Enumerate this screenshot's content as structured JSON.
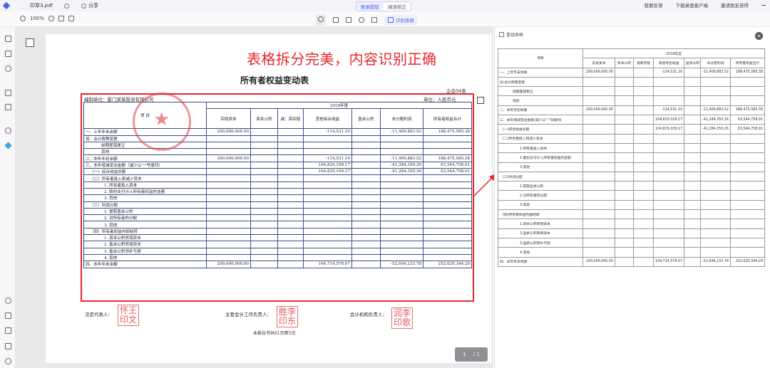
{
  "titlebar": {
    "file_name": "印章3.pdf",
    "share_label": "分享",
    "mode_tabs": [
      "数据提取",
      "阅读校正"
    ],
    "links": [
      "我要反馈",
      "下载桌面客户端",
      "邀请朋友获得"
    ]
  },
  "toolbar": {
    "zoom": "100%",
    "split_label": "识别表格"
  },
  "headline": "表格拆分完美，内容识别正确",
  "document": {
    "title": "所有者权益变动表",
    "code": "企会04表",
    "unit": "单位：人民币元",
    "company": "编制单位：厦门某某投资有限公司",
    "header": {
      "item": "项 目",
      "year": "2018年度",
      "cols": [
        "实收资本",
        "资本公积",
        "减：库存股",
        "其他综合收益",
        "盈余公积",
        "未分配利润",
        "所有者权益合计"
      ]
    },
    "rows": [
      {
        "label": "一、上年年末余额",
        "c1": "200,000,000.00",
        "c4": "-114,531.10",
        "c6": "-11,409,883.52",
        "c7": "188,475,585.38"
      },
      {
        "label": "加：会计政策变更"
      },
      {
        "label": "前期差错更正"
      },
      {
        "label": "其他"
      },
      {
        "label": "二、本年年初余额",
        "c1": "200,000,000.00",
        "c4": "-114,531.10",
        "c6": "-11,409,883.52",
        "c7": "188,475,585.38"
      },
      {
        "label": "三、本年增减变动金额（减少以\"-\"号填列）",
        "c4": "104,829,109.17",
        "c6": "-41,284,350.26",
        "c7": "63,544,758.91"
      },
      {
        "label": "（一）综合收益总额",
        "c4": "104,829,109.17",
        "c6": "-41,284,350.26",
        "c7": "63,544,758.91"
      },
      {
        "label": "（二）所有者投入和减少资本"
      },
      {
        "label": "1. 所有者投入资本"
      },
      {
        "label": "2. 股份支付计入所有者权益的金额"
      },
      {
        "label": "3. 其他"
      },
      {
        "label": "（三）利润分配"
      },
      {
        "label": "1. 提取盈余公积"
      },
      {
        "label": "2. 对所有者的分配"
      },
      {
        "label": "3. 其他"
      },
      {
        "label": "（四）所有者权益内部结转"
      },
      {
        "label": "1. 资本公积转增资本"
      },
      {
        "label": "2. 盈余公积转增资本"
      },
      {
        "label": "3. 盈余公积弥补亏损"
      },
      {
        "label": "4. 其他"
      },
      {
        "label": "四、本年年末余额",
        "c1": "200,000,000.00",
        "c4": "104,714,578.07",
        "c6": "-52,694,233.78",
        "c7": "252,020,344.29"
      }
    ],
    "signatures": {
      "legal": "法定代表人：",
      "accounting_head": "主管会计工作负责人：",
      "accounting_org": "会计机构负责人：",
      "seal1": [
        "怀王",
        "印文"
      ],
      "seal2": [
        "胜李",
        "印东"
      ],
      "seal3": [
        "润李",
        "印歌"
      ]
    },
    "footer": "本报告书共61页第5页"
  },
  "pager": {
    "current": "1",
    "total": "/ 1"
  },
  "result_panel": {
    "title": "重组表格",
    "header": {
      "item": "项目",
      "year": "2018年度",
      "cols": [
        "实收资本",
        "资本公积",
        "减库存股",
        "其他综合收益",
        "盈余公积",
        "未分配利润",
        "所有者权益合计"
      ]
    },
    "rows": [
      {
        "label": "一、上年年末余额",
        "c1": "200,000,000.00",
        "c4": "-114,531.10",
        "c6": "-11,409,883.52",
        "c7": "188,475,585.38"
      },
      {
        "label": "加:会计政策变更"
      },
      {
        "label": "前期差错更正"
      },
      {
        "label": "其他"
      },
      {
        "label": "二、本年年初余额",
        "c1": "200,000,000.00",
        "c4": "-114,531.10",
        "c6": "-11,409,883.52",
        "c7": "188,475,585.38"
      },
      {
        "label": "三、本年增减变动金额(减少以\"-\"号填列)",
        "c4": "104,829,109.17",
        "c6": "-41,284,350.26",
        "c7": "63,544,758.91"
      },
      {
        "label": "(一)综合收益总额",
        "c4": "104,829,109.17",
        "c6": "-41,284,350.26",
        "c7": "63,544,758.91"
      },
      {
        "label": "(二)所有者投入和减少资本"
      },
      {
        "label": "1.所有者投入资本"
      },
      {
        "label": "2.股份支付计入所有者权益的金额"
      },
      {
        "label": "3.其他"
      },
      {
        "label": "(三)利润分配"
      },
      {
        "label": "1.提取盈余公积"
      },
      {
        "label": "2.对所有者的分配"
      },
      {
        "label": "3.其他"
      },
      {
        "label": "(四)所有者权益内部结转"
      },
      {
        "label": "1.资本公积转增资本"
      },
      {
        "label": "2.盈余公积转增资本"
      },
      {
        "label": "3.盈余公积弥补亏损"
      },
      {
        "label": "4.其他"
      },
      {
        "label": "四、本年年末余额",
        "c1": "200,000,000.00",
        "c4": "104,714,578.07",
        "c6": "-52,694,233.78",
        "c7": "252,020,344.29"
      }
    ]
  },
  "colors": {
    "accent": "#4a63e8",
    "highlight": "#e8262c",
    "stamp": "#dc3c46"
  }
}
